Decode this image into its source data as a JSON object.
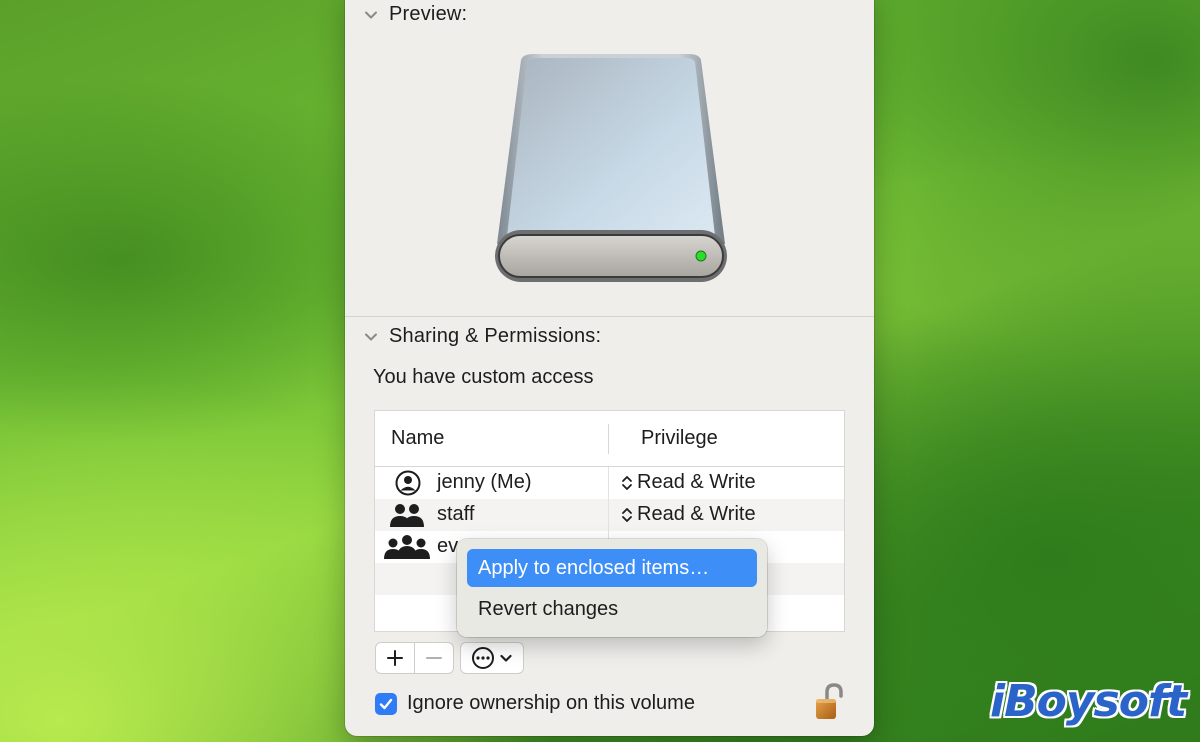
{
  "preview": {
    "label": "Preview:"
  },
  "sharing": {
    "label": "Sharing & Permissions:",
    "access_text": "You have custom access",
    "columns": {
      "name": "Name",
      "privilege": "Privilege"
    },
    "rows": [
      {
        "name": "jenny (Me)",
        "privilege": "Read & Write",
        "icon": "person-circle-icon"
      },
      {
        "name": "staff",
        "privilege": "Read & Write",
        "icon": "two-people-icon"
      },
      {
        "name": "ev",
        "privilege": "",
        "icon": "group-people-icon"
      }
    ]
  },
  "context_menu": {
    "items": [
      {
        "label": "Apply to enclosed items…",
        "highlighted": true
      },
      {
        "label": "Revert changes",
        "highlighted": false
      }
    ]
  },
  "buttons": {
    "add_icon": "plus-icon",
    "remove_icon": "minus-icon",
    "action_icon": "ellipsis-circle-icon"
  },
  "ignore_ownership": {
    "label": "Ignore ownership on this volume",
    "checked": true
  },
  "lock": {
    "icon": "lock-open-icon"
  },
  "watermark": {
    "text": "iBoysoft"
  },
  "colors": {
    "accent": "#3d8ef7",
    "checkbox": "#2f7cf6",
    "watermark": "#2a64c9"
  }
}
